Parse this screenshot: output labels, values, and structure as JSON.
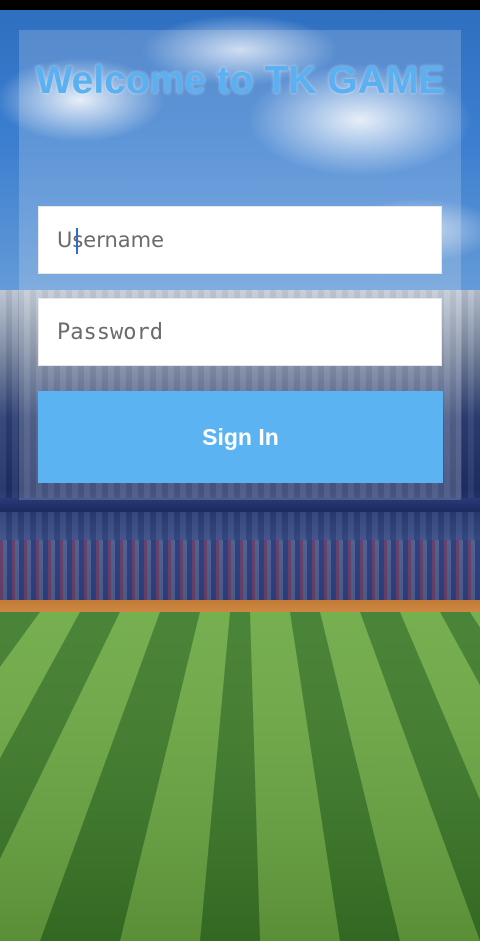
{
  "login": {
    "title": "Welcome to TK GAME",
    "username": {
      "placeholder": "Username",
      "value": ""
    },
    "password": {
      "placeholder": "Password",
      "value": ""
    },
    "sign_in_label": "Sign In"
  },
  "colors": {
    "accent": "#5cb3f2",
    "title": "#5ab0f0",
    "field_background": "#ffffff"
  },
  "background": {
    "scene": "baseball-stadium-image"
  }
}
